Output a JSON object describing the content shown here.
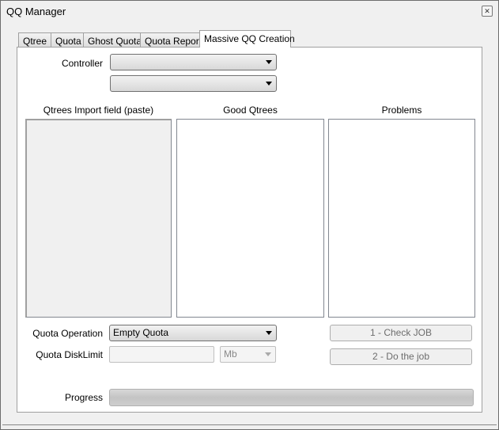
{
  "window": {
    "title": "QQ Manager",
    "close_icon": "close-icon"
  },
  "tabs": [
    {
      "label": "Qtree"
    },
    {
      "label": "Quota"
    },
    {
      "label": "Ghost Quota"
    },
    {
      "label": "Quota Report"
    },
    {
      "label": "Massive QQ Creation",
      "active": true
    }
  ],
  "form": {
    "controller_label": "Controller",
    "controller_value": "",
    "second_value": "",
    "import_header": "Qtrees Import field (paste)",
    "good_header": "Good Qtrees",
    "problems_header": "Problems",
    "quota_operation_label": "Quota Operation",
    "quota_operation_value": "Empty Quota",
    "disklimit_label": "Quota DiskLimit",
    "disklimit_value": "",
    "unit_value": "Mb",
    "check_button": "1 - Check JOB",
    "do_button": "2 - Do the job",
    "progress_label": "Progress",
    "progress_percent": 0
  }
}
